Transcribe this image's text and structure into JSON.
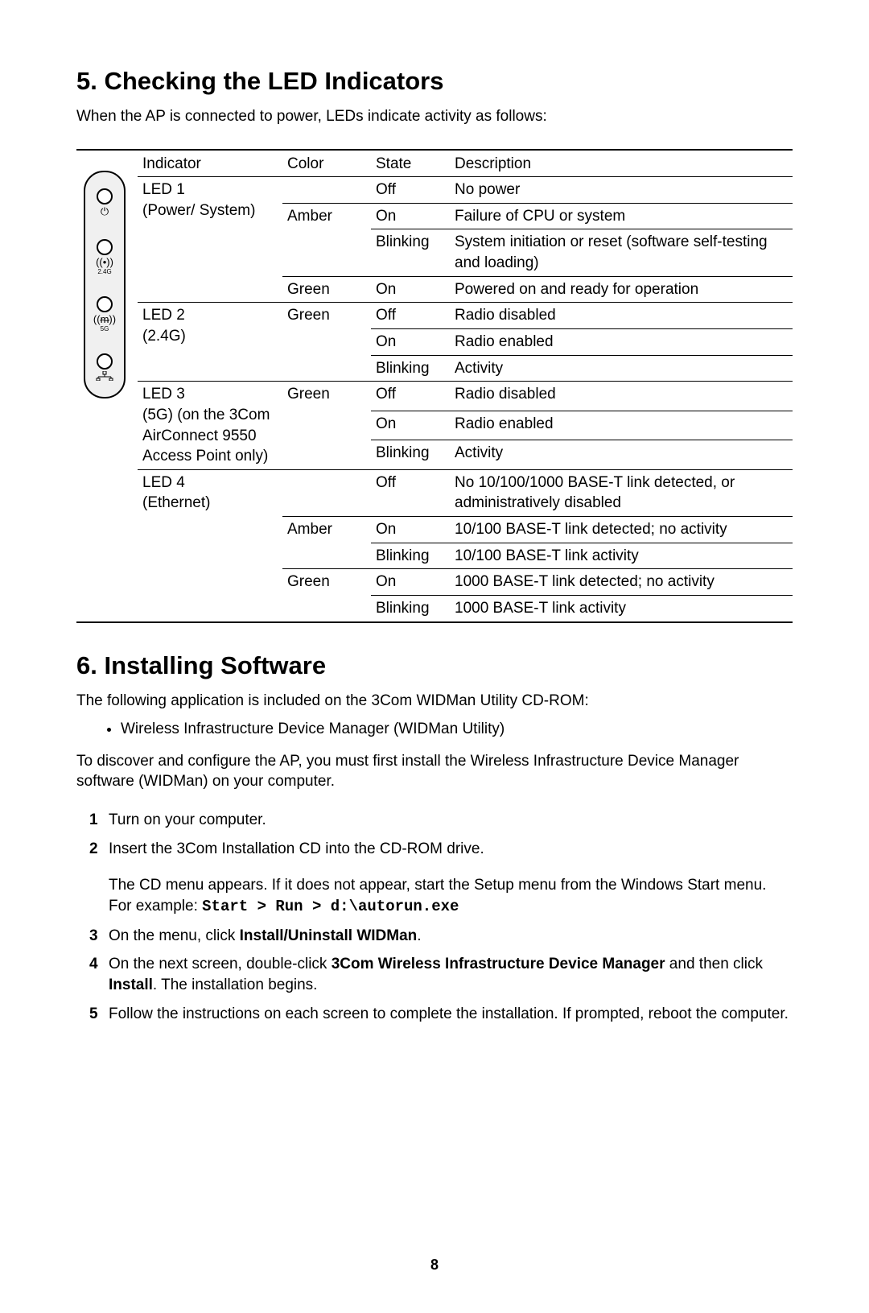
{
  "section5": {
    "heading": "5.  Checking the LED Indicators",
    "intro": "When the AP is connected to power, LEDs indicate activity as follows:",
    "headers": {
      "indicator": "Indicator",
      "color": "Color",
      "state": "State",
      "description": "Description"
    },
    "indicators": [
      {
        "name_line1": "LED 1",
        "name_rest": "(Power/ System)",
        "rows": [
          {
            "color": "",
            "state": "Off",
            "desc": "No power"
          },
          {
            "color": "Amber",
            "state": "On",
            "desc": "Failure of CPU or system"
          },
          {
            "color": "",
            "state": "Blinking",
            "desc": "System initiation or reset (software self-testing and loading)"
          },
          {
            "color": "Green",
            "state": "On",
            "desc": "Powered on and ready for operation"
          }
        ]
      },
      {
        "name_line1": "LED 2",
        "name_rest": "(2.4G)",
        "rows": [
          {
            "color": "Green",
            "state": "Off",
            "desc": "Radio disabled"
          },
          {
            "color": "",
            "state": "On",
            "desc": "Radio enabled"
          },
          {
            "color": "",
            "state": "Blinking",
            "desc": "Activity"
          }
        ]
      },
      {
        "name_line1": "LED 3",
        "name_rest": "(5G) (on the 3Com AirConnect 9550 Access Point only)",
        "rows": [
          {
            "color": "Green",
            "state": "Off",
            "desc": "Radio disabled"
          },
          {
            "color": "",
            "state": "On",
            "desc": "Radio enabled"
          },
          {
            "color": "",
            "state": "Blinking",
            "desc": "Activity"
          }
        ]
      },
      {
        "name_line1": "LED 4",
        "name_rest": "(Ethernet)",
        "rows": [
          {
            "color": "",
            "state": "Off",
            "desc": "No 10/100/1000 BASE-T link detected, or administratively disabled"
          },
          {
            "color": "Amber",
            "state": "On",
            "desc": "10/100 BASE-T link detected; no activity"
          },
          {
            "color": "",
            "state": "Blinking",
            "desc": "10/100 BASE-T link activity"
          },
          {
            "color": "Green",
            "state": "On",
            "desc": "1000 BASE-T link detected; no activity"
          },
          {
            "color": "",
            "state": "Blinking",
            "desc": "1000 BASE-T link activity"
          }
        ]
      }
    ],
    "device_labels": {
      "g24": "2.4G",
      "g5": "5G"
    }
  },
  "section6": {
    "heading": "6.  Installing Software",
    "intro": "The following application is included on the 3Com WIDMan Utility CD-ROM:",
    "bullet": "Wireless Infrastructure Device Manager (WIDMan Utility)",
    "discover": "To discover and configure the AP, you must first install the Wireless Infrastructure Device Manager software (WIDMan) on your computer.",
    "steps": {
      "s1": "Turn on your computer.",
      "s2": "Insert the 3Com Installation CD into the CD-ROM drive.",
      "s2b_a": "The CD menu appears. If it does not appear, start the Setup menu from the Windows Start menu. For example: ",
      "s2b_code": "Start > Run > d:\\autorun.exe",
      "s3_a": "On the menu, click ",
      "s3_b": "Install/Uninstall WIDMan",
      "s3_c": ".",
      "s4_a": "On the next screen, double-click ",
      "s4_b": "3Com Wireless Infrastructure Device Manager",
      "s4_c": " and then click ",
      "s4_d": "Install",
      "s4_e": ". The installation begins.",
      "s5": "Follow the instructions on each screen to complete the installation. If prompted, reboot the computer."
    }
  },
  "page_number": "8"
}
